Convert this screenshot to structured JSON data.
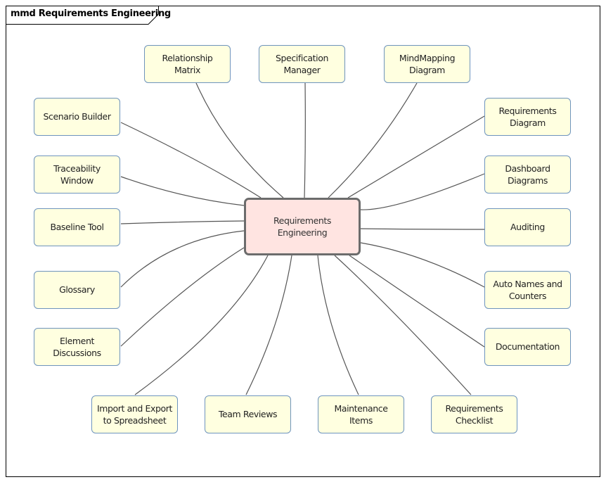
{
  "diagram": {
    "frame_title": "mmd Requirements Engineering",
    "central_topic": "Requirements\nEngineering",
    "colors": {
      "topic_fill": "#ffffe0",
      "topic_border": "#6e94bd",
      "central_fill": "#ffe4e1",
      "central_border": "#6c6c6c",
      "connector": "#555555"
    },
    "topics": [
      {
        "id": "relationship-matrix",
        "label": "Relationship\nMatrix"
      },
      {
        "id": "specification-manager",
        "label": "Specification\nManager"
      },
      {
        "id": "mindmapping-diagram",
        "label": "MindMapping\nDiagram"
      },
      {
        "id": "scenario-builder",
        "label": "Scenario Builder"
      },
      {
        "id": "traceability-window",
        "label": "Traceability\nWindow"
      },
      {
        "id": "baseline-tool",
        "label": "Baseline Tool"
      },
      {
        "id": "glossary",
        "label": "Glossary"
      },
      {
        "id": "element-discussions",
        "label": "Element\nDiscussions"
      },
      {
        "id": "requirements-diagram",
        "label": "Requirements\nDiagram"
      },
      {
        "id": "dashboard-diagrams",
        "label": "Dashboard\nDiagrams"
      },
      {
        "id": "auditing",
        "label": "Auditing"
      },
      {
        "id": "auto-names-and-counters",
        "label": "Auto Names and\nCounters"
      },
      {
        "id": "documentation",
        "label": "Documentation"
      },
      {
        "id": "import-export-spreadsheet",
        "label": "Import and Export\nto Spreadsheet"
      },
      {
        "id": "team-reviews",
        "label": "Team Reviews"
      },
      {
        "id": "maintenance-items",
        "label": "Maintenance\nItems"
      },
      {
        "id": "requirements-checklist",
        "label": "Requirements\nChecklist"
      }
    ]
  }
}
